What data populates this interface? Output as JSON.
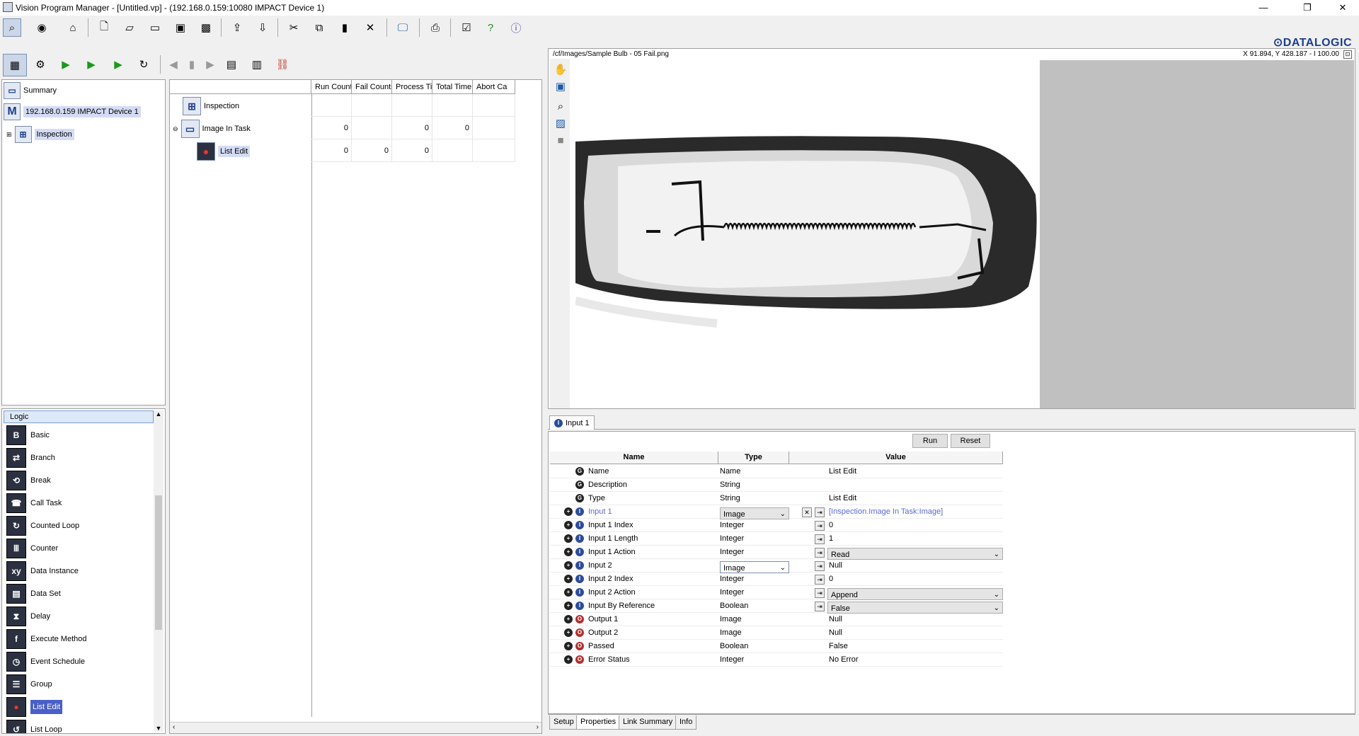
{
  "window": {
    "title": "Vision Program Manager - [Untitled.vp] - (192.168.0.159:10080 IMPACT Device 1)",
    "brand": "DATALOGIC",
    "min": "—",
    "restore": "❐",
    "close": "✕"
  },
  "toolbar_icons": [
    "magnifier-icon",
    "record-icon",
    "home-icon",
    "new-icon",
    "open-icon",
    "folder-icon",
    "save-icon",
    "save-all-icon",
    "upload-icon",
    "download-icon",
    "cut-icon",
    "copy-icon",
    "paste-icon",
    "delete-icon",
    "monitor-icon",
    "print-icon",
    "checklist-icon",
    "help-icon",
    "about-icon"
  ],
  "tree": {
    "summary": "Summary",
    "device": "192.168.0.159 IMPACT Device 1",
    "device_badge": "M",
    "inspection": "Inspection"
  },
  "grid": {
    "columns": [
      "Run Counts",
      "Fail Counts",
      "Process Ti...",
      "Total Time",
      "Abort Ca"
    ],
    "rows": [
      {
        "name": "Inspection",
        "values": [
          "",
          "",
          "",
          "",
          ""
        ]
      },
      {
        "name": "Image In Task",
        "values": [
          "0",
          "",
          "0",
          "0",
          ""
        ]
      },
      {
        "name": "List Edit",
        "values": [
          "0",
          "0",
          "0",
          "",
          ""
        ]
      }
    ]
  },
  "logic": {
    "header": "Logic",
    "items": [
      {
        "label": "Basic",
        "glyph": "B"
      },
      {
        "label": "Branch",
        "glyph": "⇄"
      },
      {
        "label": "Break",
        "glyph": "⟲"
      },
      {
        "label": "Call Task",
        "glyph": "☎"
      },
      {
        "label": "Counted Loop",
        "glyph": "↻"
      },
      {
        "label": "Counter",
        "glyph": "Ⅲ"
      },
      {
        "label": "Data Instance",
        "glyph": "xy"
      },
      {
        "label": "Data Set",
        "glyph": "▤"
      },
      {
        "label": "Delay",
        "glyph": "⧗"
      },
      {
        "label": "Execute Method",
        "glyph": "f"
      },
      {
        "label": "Event Schedule",
        "glyph": "◷"
      },
      {
        "label": "Group",
        "glyph": "☰"
      },
      {
        "label": "List Edit",
        "glyph": "●"
      },
      {
        "label": "List Loop",
        "glyph": "↺"
      }
    ]
  },
  "image": {
    "path": "/cf/Images/Sample Bulb - 05 Fail.png",
    "coords": "X 91.894,  Y 428.187  -  I 100.00"
  },
  "props": {
    "tab": "Input 1",
    "run": "Run",
    "reset": "Reset",
    "headers": {
      "name": "Name",
      "type": "Type",
      "value": "Value"
    },
    "rows": [
      {
        "name": "Name",
        "type": "Name",
        "value": "List Edit",
        "kind": "G"
      },
      {
        "name": "Description",
        "type": "String",
        "value": "",
        "kind": "G"
      },
      {
        "name": "Type",
        "type": "String",
        "value": "List Edit",
        "kind": "G"
      },
      {
        "name": "Input 1",
        "type": "Image",
        "value": "[Inspection.Image In Task:Image]",
        "kind": "I"
      },
      {
        "name": "Input 1 Index",
        "type": "Integer",
        "value": "0",
        "kind": "I"
      },
      {
        "name": "Input 1 Length",
        "type": "Integer",
        "value": "1",
        "kind": "I"
      },
      {
        "name": "Input 1 Action",
        "type": "Integer",
        "value": "Read",
        "kind": "I"
      },
      {
        "name": "Input 2",
        "type": "Image",
        "value": "Null",
        "kind": "I"
      },
      {
        "name": "Input 2 Index",
        "type": "Integer",
        "value": "0",
        "kind": "I"
      },
      {
        "name": "Input 2 Action",
        "type": "Integer",
        "value": "Append",
        "kind": "I"
      },
      {
        "name": "Input By Reference",
        "type": "Boolean",
        "value": "False",
        "kind": "I"
      },
      {
        "name": "Output 1",
        "type": "Image",
        "value": "Null",
        "kind": "O"
      },
      {
        "name": "Output 2",
        "type": "Image",
        "value": "Null",
        "kind": "O"
      },
      {
        "name": "Passed",
        "type": "Boolean",
        "value": "False",
        "kind": "O"
      },
      {
        "name": "Error Status",
        "type": "Integer",
        "value": "No Error",
        "kind": "O"
      }
    ]
  },
  "bottom_tabs": [
    "Setup",
    "Properties",
    "Link Summary",
    "Info"
  ]
}
